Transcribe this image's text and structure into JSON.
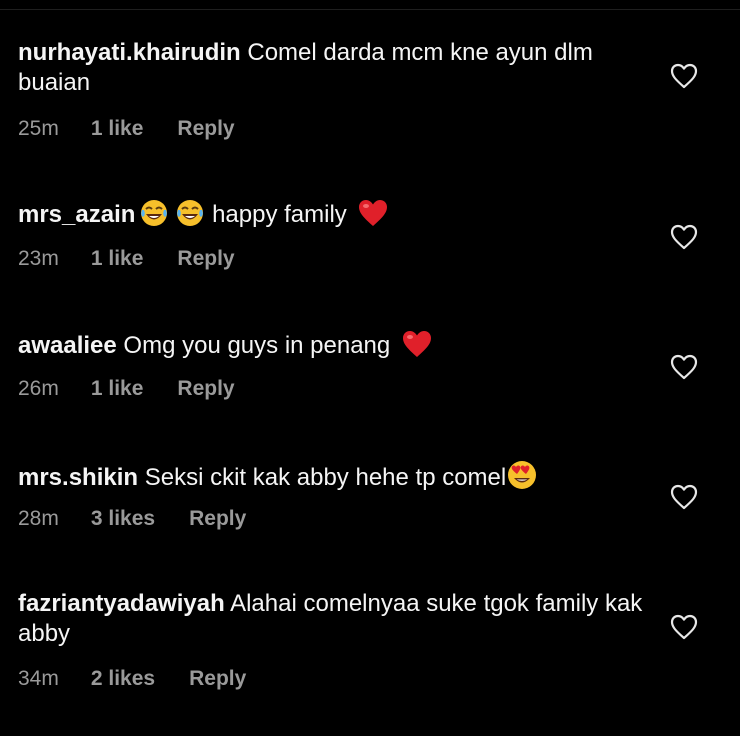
{
  "comments": [
    {
      "username": "nurhayati.khairudin",
      "text": " Comel darda mcm kne ayun dlm buaian",
      "emojis": [],
      "time": "25m",
      "likes": "1 like",
      "reply": "Reply"
    },
    {
      "username": "mrs_azain",
      "text": " happy family ",
      "lead_emojis": [
        "face-with-tears-of-joy",
        "face-with-tears-of-joy"
      ],
      "trail_emojis": [
        "red-heart"
      ],
      "time": "23m",
      "likes": "1 like",
      "reply": "Reply"
    },
    {
      "username": "awaaliee",
      "text": " Omg you guys in penang ",
      "trail_emojis": [
        "red-heart"
      ],
      "time": "26m",
      "likes": "1 like",
      "reply": "Reply"
    },
    {
      "username": "mrs.shikin",
      "text": " Seksi ckit kak abby hehe tp comel",
      "trail_emojis": [
        "smiling-face-with-heart-eyes"
      ],
      "time": "28m",
      "likes": "3 likes",
      "reply": "Reply"
    },
    {
      "username": "fazriantyadawiyah",
      "text": " Alahai comelnyaa suke tgok family kak abby",
      "trail_emojis": [],
      "time": "34m",
      "likes": "2 likes",
      "reply": "Reply"
    }
  ],
  "colors": {
    "background": "#000000",
    "text": "#f5f5f5",
    "meta": "#9a9a9a",
    "heart_outline": "#e8e8e8",
    "emoji_heart": "#e0202a",
    "emoji_face": "#f7c02b"
  }
}
